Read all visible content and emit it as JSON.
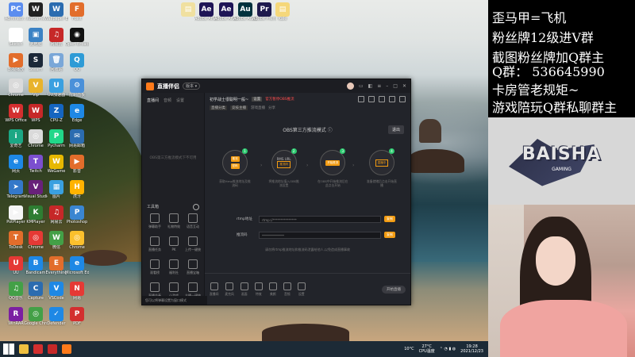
{
  "desktop": {
    "icons_left": [
      {
        "label": "Administr...",
        "color": "#5b8def",
        "glyph": "PC"
      },
      {
        "label": "WeGame",
        "color": "#222222",
        "glyph": "W"
      },
      {
        "label": "Wallpaper Engine",
        "color": "#2b6cb0",
        "glyph": "W"
      },
      {
        "label": "Foxit",
        "color": "#e26d2b",
        "glyph": "F"
      },
      {
        "label": "Sketch",
        "color": "#ffffff",
        "glyph": "✎"
      },
      {
        "label": "此电脑",
        "color": "#3b82c4",
        "glyph": "▣"
      },
      {
        "label": "网易云",
        "color": "#c62828",
        "glyph": "♫"
      },
      {
        "label": "Open Broadcast",
        "color": "#111111",
        "glyph": "◉"
      },
      {
        "label": "影视播放",
        "color": "#e26d2b",
        "glyph": "▶"
      },
      {
        "label": "Steam",
        "color": "#1b2838",
        "glyph": "S"
      },
      {
        "label": "回收站",
        "color": "#7aa7d8",
        "glyph": "🗑"
      },
      {
        "label": "QQ",
        "color": "#2e9bd6",
        "glyph": "Q"
      },
      {
        "label": "Chrome",
        "color": "#dadada",
        "glyph": "◎"
      },
      {
        "label": "Vip",
        "color": "#e8b32c",
        "glyph": "V"
      },
      {
        "label": "UU加速器",
        "color": "#3aa0e0",
        "glyph": "U"
      },
      {
        "label": "控制面板",
        "color": "#4a90d9",
        "glyph": "⚙"
      },
      {
        "label": "WPS Office",
        "color": "#d32f2f",
        "glyph": "W"
      },
      {
        "label": "WPS",
        "color": "#c62828",
        "glyph": "W"
      },
      {
        "label": "CPU-Z",
        "color": "#1565c0",
        "glyph": "Z"
      },
      {
        "label": "Edge",
        "color": "#1e88e5",
        "glyph": "e"
      },
      {
        "label": "爱奇艺",
        "color": "#1ba784",
        "glyph": "i"
      },
      {
        "label": "Chrome",
        "color": "#dadada",
        "glyph": "◎"
      },
      {
        "label": "Pycharm",
        "color": "#21d789",
        "glyph": "P"
      },
      {
        "label": "网易邮箱",
        "color": "#2b6cb0",
        "glyph": "✉"
      },
      {
        "label": "网页",
        "color": "#1e88e5",
        "glyph": "e"
      },
      {
        "label": "Twitch",
        "color": "#7b4fcf",
        "glyph": "T"
      },
      {
        "label": "WeGame",
        "color": "#e6b800",
        "glyph": "W"
      },
      {
        "label": "影音",
        "color": "#e26d2b",
        "glyph": "▶"
      },
      {
        "label": "Telegram",
        "color": "#3478c9",
        "glyph": "➤"
      },
      {
        "label": "Visual Studio",
        "color": "#68217a",
        "glyph": "V"
      },
      {
        "label": "图片",
        "color": "#3aa0e0",
        "glyph": "▦"
      },
      {
        "label": "虎牙",
        "color": "#ffb300",
        "glyph": "H"
      },
      {
        "label": "PotPlayer",
        "color": "#f5f5f5",
        "glyph": "▶"
      },
      {
        "label": "KMPlayer",
        "color": "#2e7d32",
        "glyph": "K"
      },
      {
        "label": "网易云",
        "color": "#c62828",
        "glyph": "♫"
      },
      {
        "label": "Photoshop",
        "color": "#3a86d1",
        "glyph": "P"
      },
      {
        "label": "ToDesk",
        "color": "#e26d2b",
        "glyph": "T"
      },
      {
        "label": "Chrome",
        "color": "#e53935",
        "glyph": "◎"
      },
      {
        "label": "微信",
        "color": "#43a047",
        "glyph": "W"
      },
      {
        "label": "Chrome",
        "color": "#fbc02d",
        "glyph": "◎"
      },
      {
        "label": "UU",
        "color": "#e53935",
        "glyph": "U"
      },
      {
        "label": "Bandicam",
        "color": "#1e88e5",
        "glyph": "B"
      },
      {
        "label": "Everything",
        "color": "#e26d2b",
        "glyph": "E"
      },
      {
        "label": "Microsoft Edge",
        "color": "#1e88e5",
        "glyph": "e"
      },
      {
        "label": "QQ音乐",
        "color": "#43a047",
        "glyph": "♫"
      },
      {
        "label": "Capture",
        "color": "#2b6cb0",
        "glyph": "C"
      },
      {
        "label": "VSCode",
        "color": "#1e88e5",
        "glyph": "V"
      },
      {
        "label": "网易",
        "color": "#e53935",
        "glyph": "N"
      },
      {
        "label": "WinRAR",
        "color": "#7b1fa2",
        "glyph": "R"
      },
      {
        "label": "Google Chrome",
        "color": "#43a047",
        "glyph": "◎"
      },
      {
        "label": "Defender",
        "color": "#1e88e5",
        "glyph": "✓"
      },
      {
        "label": "PDF",
        "color": "#d32f2f",
        "glyph": "P"
      }
    ],
    "icons_top": [
      {
        "label": "",
        "color": "#f0e0a0",
        "glyph": "▤"
      },
      {
        "label": "Adobe After Effects 2021",
        "color": "#1f1556",
        "glyph": "Ae"
      },
      {
        "label": "Adobe After Effects",
        "color": "#1f1556",
        "glyph": "Ae"
      },
      {
        "label": "Adobe Audition",
        "color": "#00313d",
        "glyph": "Au"
      },
      {
        "label": "Adobe Premiere",
        "color": "#1f1a4d",
        "glyph": "Pr"
      },
      {
        "label": "Kale",
        "color": "#f5d77a",
        "glyph": "▤"
      }
    ]
  },
  "app": {
    "title": "直播伴侣",
    "version": "版本 ▾",
    "sidebar_tabs": [
      "直播间",
      "音频",
      "设置"
    ],
    "sidebar_empty": "OBS第三方推流模式下不可用",
    "tools_header": "工具箱",
    "tools": [
      "弹幕助手",
      "礼物特效",
      "语音互动",
      "直播任务",
      "PK",
      "上传一键统",
      "观看榜",
      "福利社",
      "直播宝箱",
      "直播节奏",
      "小游戏",
      "主播一键统"
    ],
    "status_bar": "您可以将弹幕设置为窗口模式",
    "header": {
      "title": "初学战士很聪明一般~",
      "badge": "设置",
      "warning": "官方暂停OBS推流",
      "row2": [
        "直播分类",
        "竞技主播",
        "游戏直播",
        "分享"
      ]
    },
    "obs_mode_title": "OBS第三方推流模式 ⓘ",
    "return_label": "退出",
    "steps": [
      {
        "num": "1",
        "chip1": "推流",
        "chip2": "密码",
        "desc": "获取rtmp推流地址及推流码"
      },
      {
        "num": "2",
        "top": "RMS URL",
        "chip": "推流码",
        "desc": "将推流地址填入OBS推流设置"
      },
      {
        "num": "3",
        "chip": "开始推流",
        "desc": "在OBS中开始推流后在此点击开始"
      },
      {
        "num": "4",
        "chip": "直播中",
        "desc": "准备就绪后点击开始直播"
      }
    ],
    "rtmp_label": "rtmp地址",
    "rtmp_value": "rtmp://***************",
    "key_label": "推流码",
    "key_value": "**************",
    "copy_label": "复制",
    "hint": "请勿将rtmp推流地址和推流码泄露给他人,以免造成直播事故",
    "bottom_items": [
      "直播间",
      "麦克风",
      "画面",
      "特效",
      "美颜",
      "音频",
      "设置"
    ],
    "live_button": "开始直播"
  },
  "overlay": {
    "lines": [
      "歪马甲=飞机",
      "粉丝牌12级进V群",
      "截图粉丝牌加Q群主",
      "Q群：  536645990",
      "卡房管老规矩~",
      "游戏陪玩Q群私聊群主"
    ],
    "logo_text": "BAISHA",
    "logo_sub": "GAMING"
  },
  "taskbar": {
    "weather": "10°C",
    "weather2": "27°C",
    "cpu": "CPU温度",
    "time": "19:28",
    "date": "2021/12/23"
  }
}
